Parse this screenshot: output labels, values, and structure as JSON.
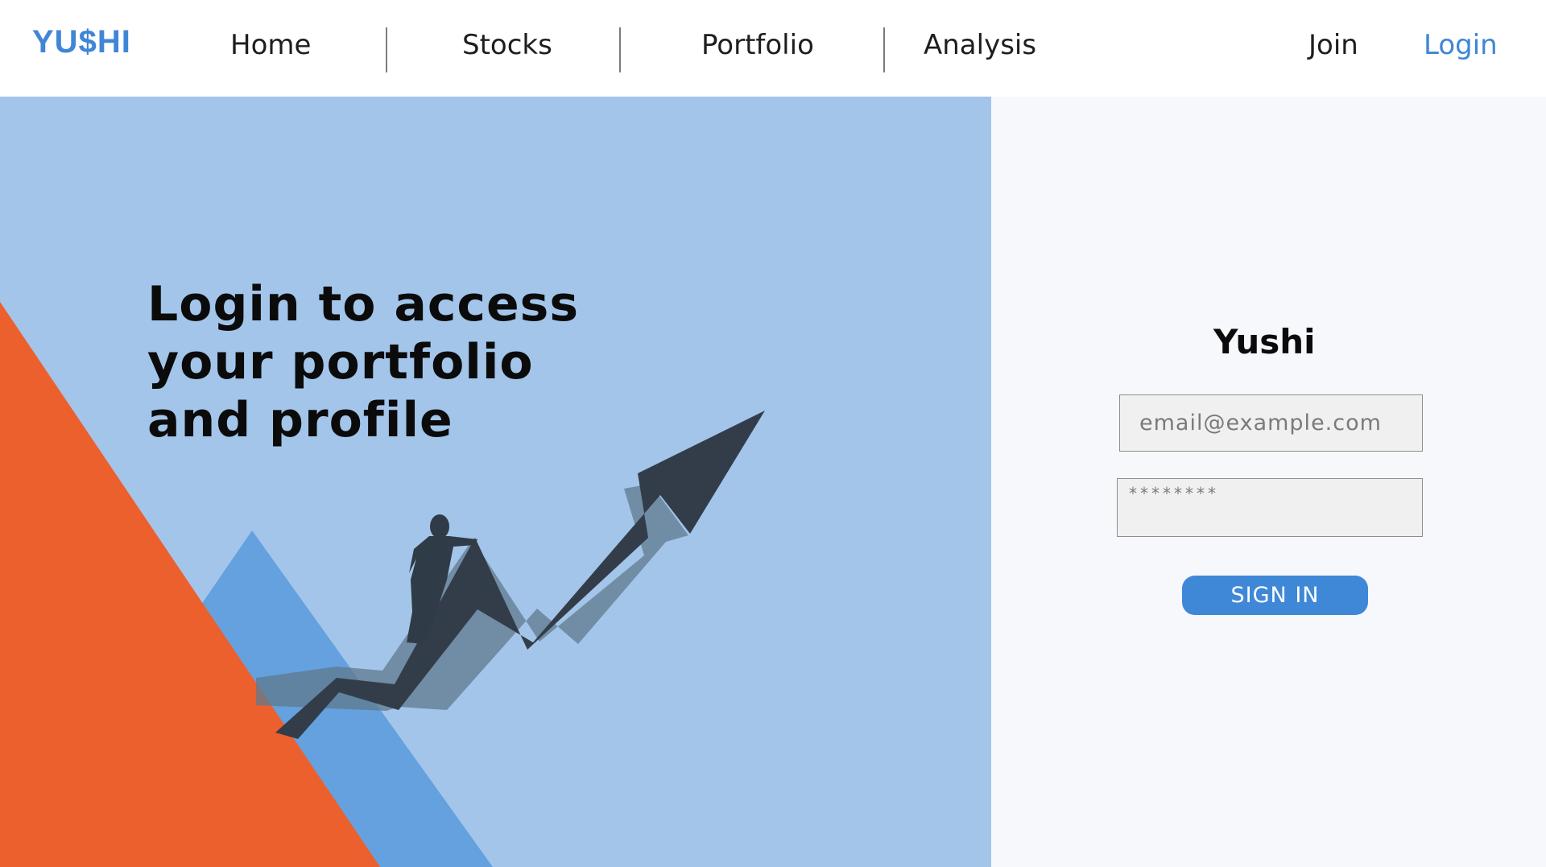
{
  "header": {
    "logo": "YU$HI",
    "nav": [
      {
        "label": "Home"
      },
      {
        "label": "Stocks"
      },
      {
        "label": "Portfolio"
      },
      {
        "label": "Analysis"
      }
    ],
    "join_label": "Join",
    "login_label": "Login"
  },
  "hero": {
    "title_lines": [
      "Login to access",
      "your portfolio",
      "and profile"
    ]
  },
  "login_panel": {
    "title": "Yushi",
    "email_placeholder": "email@example.com",
    "password_placeholder": "********",
    "signin_label": "SIGN IN"
  },
  "colors": {
    "brand_blue": "#3f86d6",
    "hero_background": "#a3c5ea",
    "mid_blue": "#65a1de",
    "orange": "#ec602e",
    "arrow_dark": "#333d4a",
    "panel_background": "#f7f8fc",
    "button_blue": "#3f88d8"
  },
  "icons": {
    "hero_illustration": "businessman-climbing-growth-arrow"
  }
}
